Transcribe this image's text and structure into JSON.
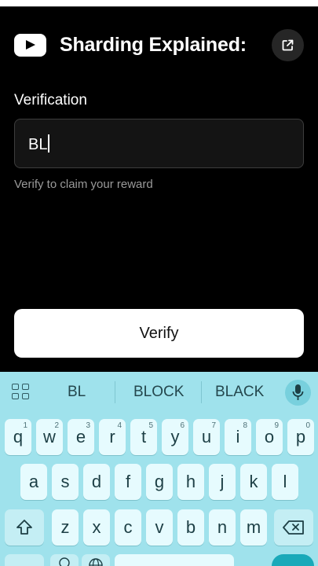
{
  "header": {
    "title": "Sharding Explained:",
    "logo_icon": "youtube-logo-icon",
    "share_icon": "external-link-icon"
  },
  "form": {
    "label": "Verification",
    "input_value": "BL",
    "helper": "Verify to claim your reward",
    "button_label": "Verify"
  },
  "keyboard": {
    "suggestions": [
      "BL",
      "BLOCK",
      "BLACK"
    ],
    "rows": [
      [
        {
          "k": "q",
          "h": "1"
        },
        {
          "k": "w",
          "h": "2"
        },
        {
          "k": "e",
          "h": "3"
        },
        {
          "k": "r",
          "h": "4"
        },
        {
          "k": "t",
          "h": "5"
        },
        {
          "k": "y",
          "h": "6"
        },
        {
          "k": "u",
          "h": "7"
        },
        {
          "k": "i",
          "h": "8"
        },
        {
          "k": "o",
          "h": "9"
        },
        {
          "k": "p",
          "h": "0"
        }
      ],
      [
        {
          "k": "a"
        },
        {
          "k": "s"
        },
        {
          "k": "d"
        },
        {
          "k": "f"
        },
        {
          "k": "g"
        },
        {
          "k": "h"
        },
        {
          "k": "j"
        },
        {
          "k": "k"
        },
        {
          "k": "l"
        }
      ],
      [
        {
          "k": "z"
        },
        {
          "k": "x"
        },
        {
          "k": "c"
        },
        {
          "k": "v"
        },
        {
          "k": "b"
        },
        {
          "k": "n"
        },
        {
          "k": "m"
        }
      ]
    ],
    "colors": {
      "background": "#9fe2ec",
      "key": "#e6fbfe",
      "key_text": "#1d3f45"
    }
  }
}
